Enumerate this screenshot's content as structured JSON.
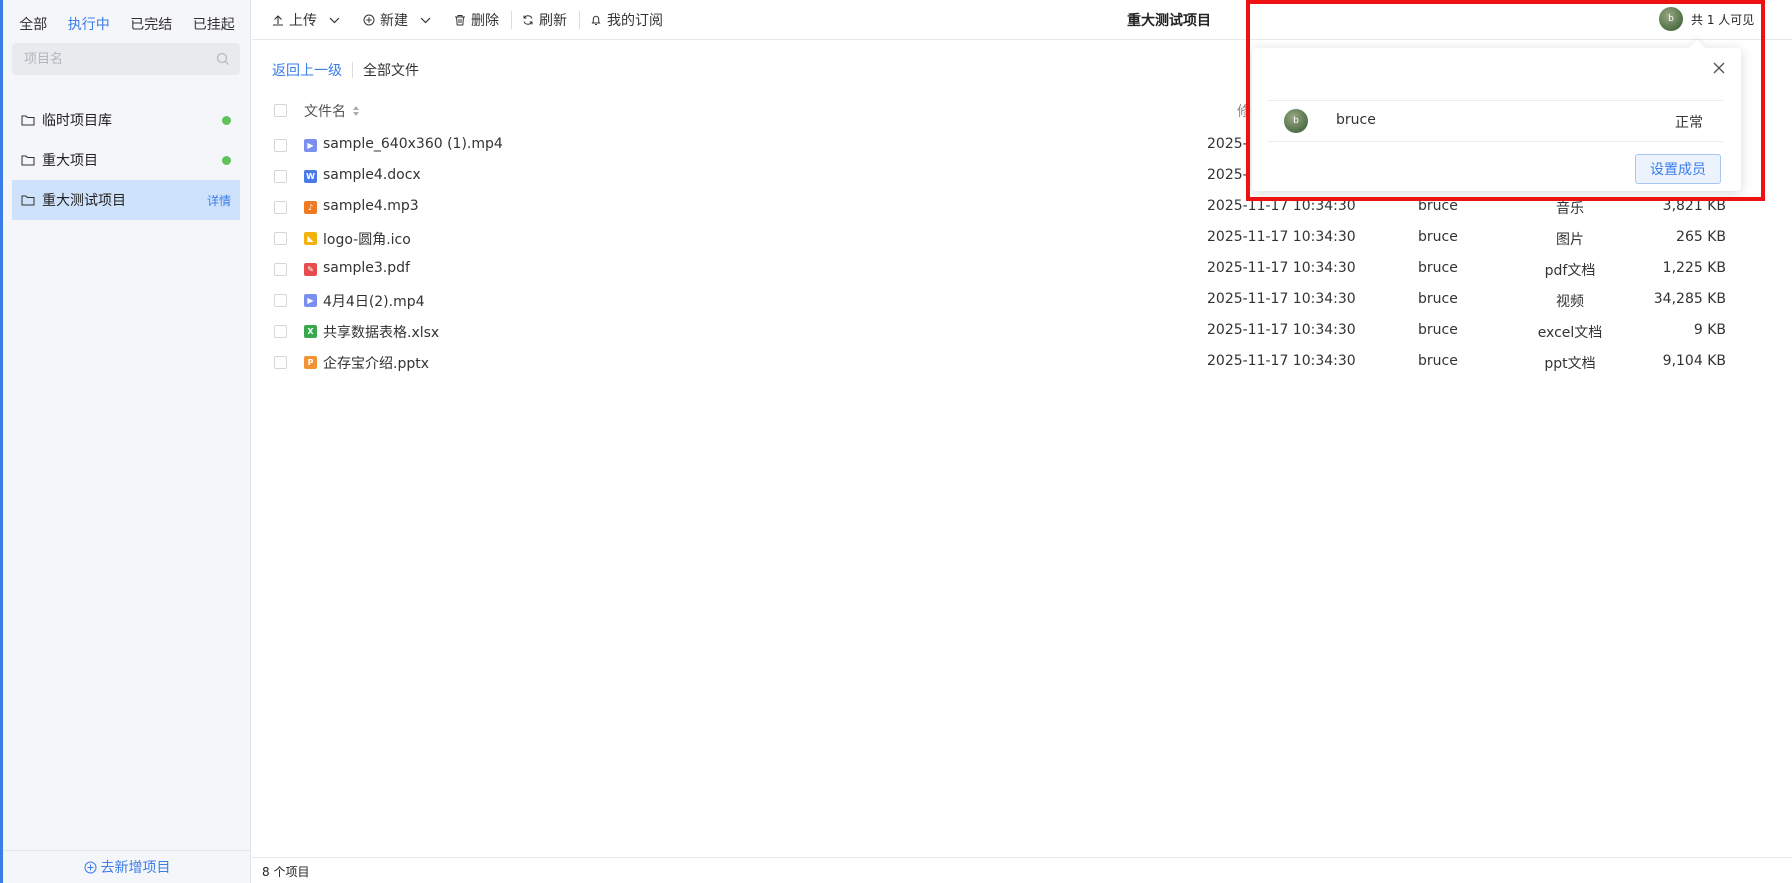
{
  "sidebar": {
    "status_tabs": [
      {
        "label": "全部"
      },
      {
        "label": "执行中",
        "active": true
      },
      {
        "label": "已完结"
      },
      {
        "label": "已挂起"
      }
    ],
    "search_placeholder": "项目名",
    "projects": [
      {
        "name": "临时项目库",
        "status_dot": true
      },
      {
        "name": "重大项目",
        "status_dot": true
      },
      {
        "name": "重大测试项目",
        "selected": true,
        "detail_label": "详情"
      }
    ],
    "add_project_label": "去新增项目"
  },
  "toolbar": {
    "upload_label": "上传",
    "new_label": "新建",
    "delete_label": "删除",
    "refresh_label": "刷新",
    "subscribe_label": "我的订阅",
    "project_title": "重大测试项目",
    "visible_label": "共 1 人可见",
    "avatar_letter": "b"
  },
  "breadcrumb": {
    "back_label": "返回上一级",
    "current_label": "全部文件"
  },
  "table": {
    "header_name": "文件名",
    "header_modified_partial": "修",
    "rows": [
      {
        "name": "sample_640x360 (1).mp4",
        "icon": "video-file-icon",
        "icon_color": "#7b8ff0",
        "icon_glyph": "▶",
        "date": "2025-",
        "owner": "",
        "type": "",
        "size": ""
      },
      {
        "name": "sample4.docx",
        "icon": "word-file-icon",
        "icon_color": "#4a7ae8",
        "icon_glyph": "W",
        "date": "2025-",
        "owner": "",
        "type": "",
        "size": ""
      },
      {
        "name": "sample4.mp3",
        "icon": "audio-file-icon",
        "icon_color": "#ee7a22",
        "icon_glyph": "♪",
        "date": "2025-11-17 10:34:30",
        "owner": "bruce",
        "type": "音乐",
        "size": "3,821 KB"
      },
      {
        "name": "logo-圆角.ico",
        "icon": "image-file-icon",
        "icon_color": "#f4b20c",
        "icon_glyph": "◣",
        "date": "2025-11-17 10:34:30",
        "owner": "bruce",
        "type": "图片",
        "size": "265 KB"
      },
      {
        "name": "sample3.pdf",
        "icon": "pdf-file-icon",
        "icon_color": "#e84c4c",
        "icon_glyph": "✎",
        "date": "2025-11-17 10:34:30",
        "owner": "bruce",
        "type": "pdf文档",
        "size": "1,225 KB"
      },
      {
        "name": "4月4日(2).mp4",
        "icon": "video-file-icon",
        "icon_color": "#7b8ff0",
        "icon_glyph": "▶",
        "date": "2025-11-17 10:34:30",
        "owner": "bruce",
        "type": "视频",
        "size": "34,285 KB"
      },
      {
        "name": "共享数据表格.xlsx",
        "icon": "excel-file-icon",
        "icon_color": "#3aa94d",
        "icon_glyph": "X",
        "date": "2025-11-17 10:34:30",
        "owner": "bruce",
        "type": "excel文档",
        "size": "9 KB"
      },
      {
        "name": "企存宝介绍.pptx",
        "icon": "ppt-file-icon",
        "icon_color": "#f39334",
        "icon_glyph": "P",
        "date": "2025-11-17 10:34:30",
        "owner": "bruce",
        "type": "ppt文档",
        "size": "9,104 KB"
      }
    ]
  },
  "footer": {
    "count_label": "8 个项目"
  },
  "popover": {
    "member_avatar": "b",
    "member_name": "bruce",
    "member_status": "正常",
    "set_members_label": "设置成员"
  },
  "colors": {
    "accent": "#3b7de9",
    "highlight": "#ee1111",
    "status_dot": "#5fc25c"
  }
}
